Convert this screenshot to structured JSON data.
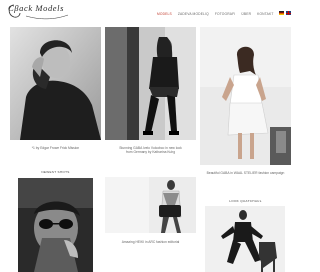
{
  "header": {
    "logo_text": "Cβack Models",
    "nav": [
      {
        "label": "Models",
        "active": true
      },
      {
        "label": "Zadeva modeliq",
        "active": false
      },
      {
        "label": "Fotografi",
        "active": false
      },
      {
        "label": "Über",
        "active": false
      },
      {
        "label": "Kontakt",
        "active": false
      }
    ],
    "flags": [
      "de-flag-icon",
      "en-flag-icon"
    ]
  },
  "cards": [
    {
      "caption": "*1 by Edgar Frowe Frick Mission",
      "icon": "man-portrait-photo"
    },
    {
      "caption": "Stunning GABA Ivelo Vulcobco in new look from Germany by Katharina Kuhg",
      "icon": "woman-boots-photo"
    },
    {
      "caption": "Beautiful GABA in WAAL STELIER fashion campaign",
      "icon": "woman-white-dress-photo"
    }
  ],
  "sections": {
    "left_title": "Newest shots",
    "right_title": "Look quatchaul"
  },
  "bottom_cards": [
    {
      "caption": "",
      "icon": "man-sunglasses-photo"
    },
    {
      "caption": "Amazing HEIKI in ARC fashion editorial",
      "icon": "woman-handbag-photo"
    },
    {
      "caption": "",
      "icon": "woman-chair-photo"
    }
  ],
  "colors": {
    "accent": "#c0392b",
    "text": "#666666",
    "background": "#ffffff"
  }
}
